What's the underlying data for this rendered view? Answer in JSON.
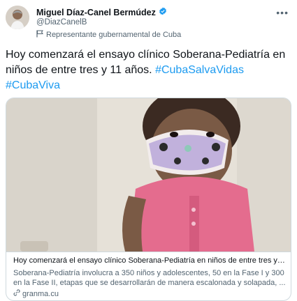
{
  "author": {
    "name": "Miguel Díaz-Canel Bermúdez",
    "handle": "@DiazCanelB",
    "label": "Representante gubernamental de Cuba",
    "verified_color": "#1d9bf0"
  },
  "tweet": {
    "text": "Hoy comenzará el ensayo clínico Soberana-Pediatría en niños de entre tres y 11 años.",
    "hashtags": [
      "#CubaSalvaVidas",
      "#CubaViva"
    ]
  },
  "card": {
    "title": "Hoy comenzará el ensayo clínico Soberana-Pediatría en niños de entre tres y 11...",
    "description": "Soberana-Pediatría involucra a 350 niños y adolescentes, 50 en la Fase I y 300 en la Fase II, etapas que se desarrollarán de manera escalonada y solapada, ...",
    "domain": "granma.cu"
  },
  "icons": {
    "more": "more-icon",
    "verified": "verified-badge-icon",
    "flag": "flag-icon",
    "link": "link-icon"
  }
}
